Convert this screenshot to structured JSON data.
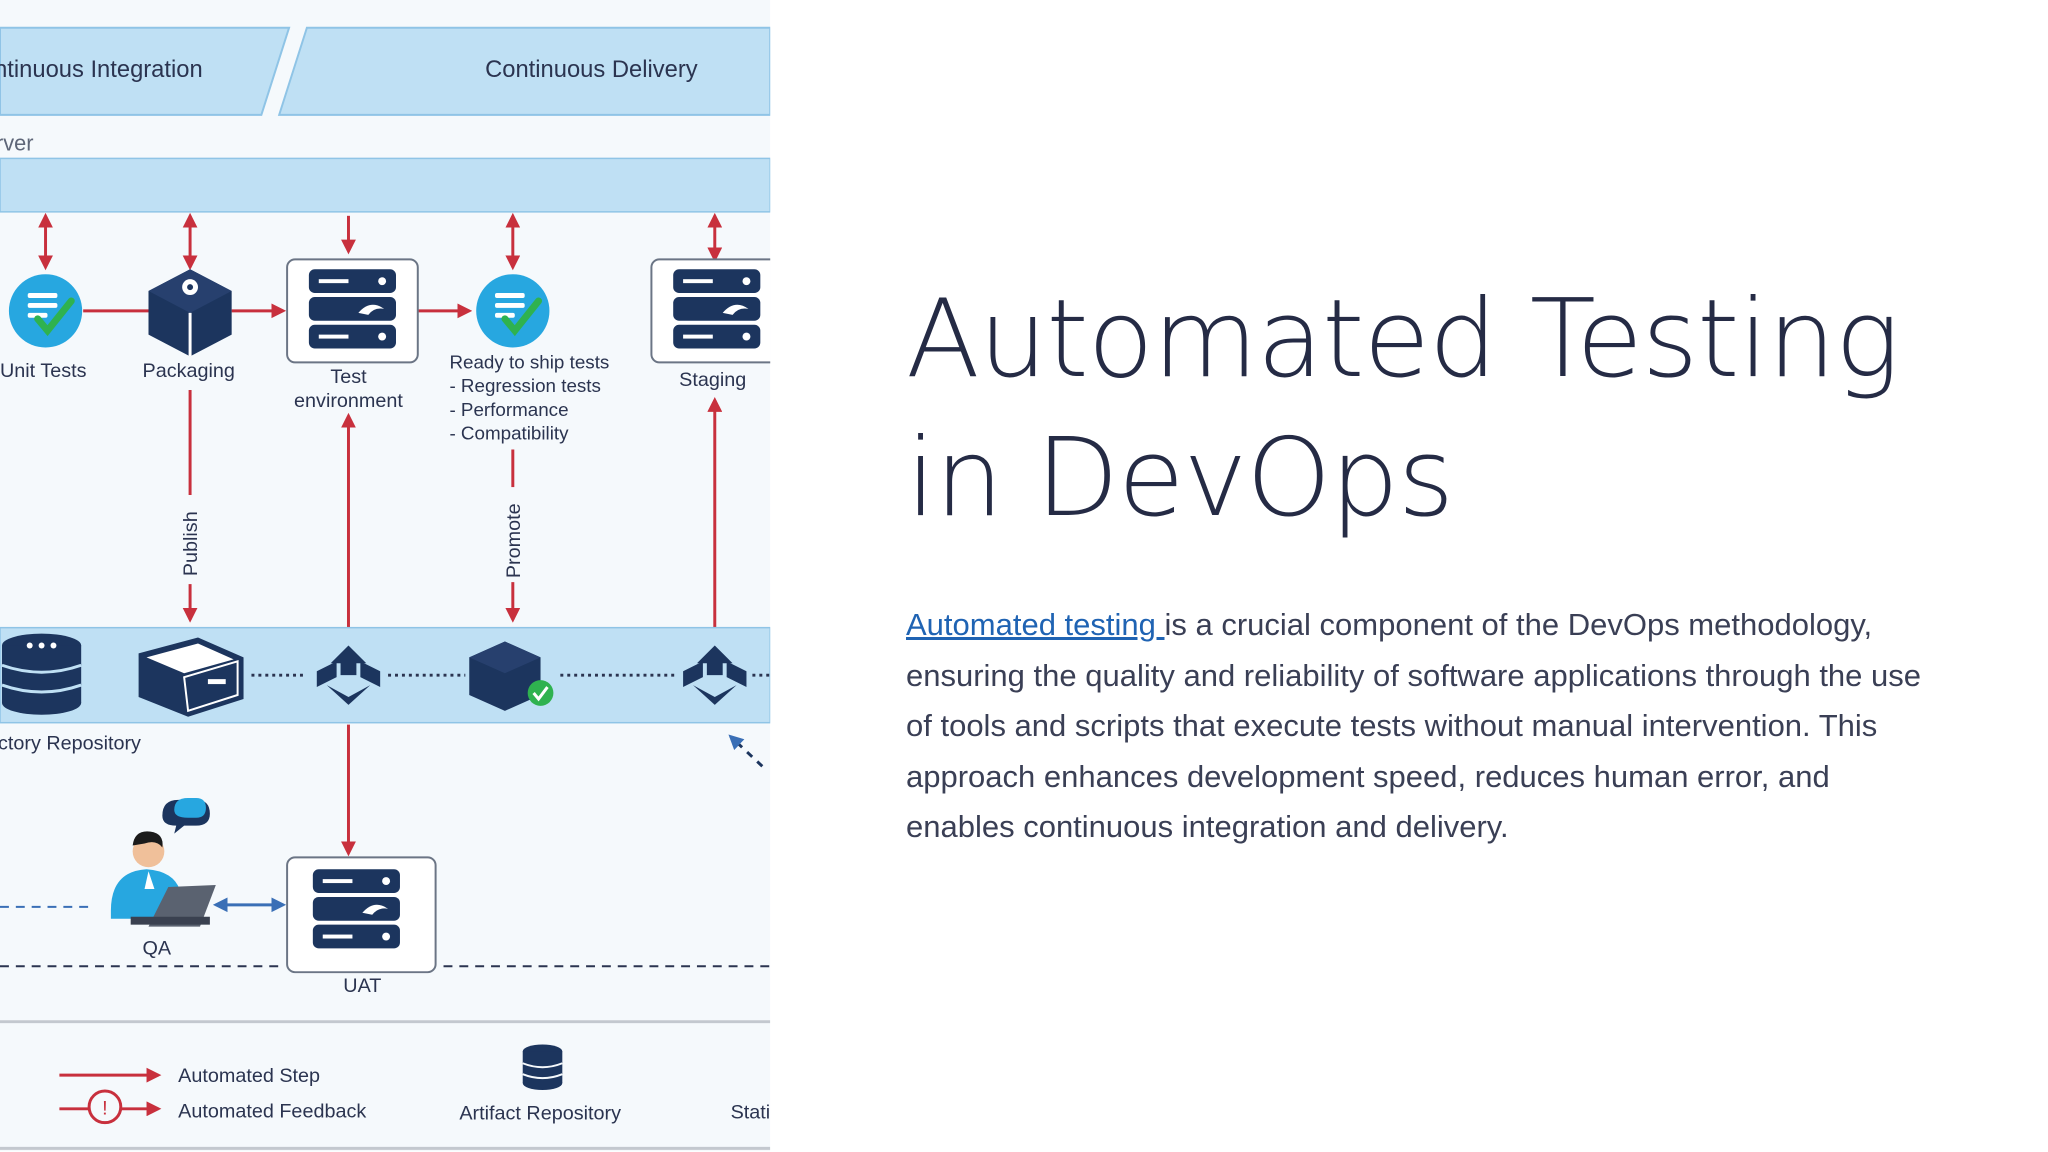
{
  "diagram": {
    "phases": [
      "ntinuous Integration",
      "Continuous Delivery"
    ],
    "server_label": "rver",
    "steps": {
      "unit_tests": "Unit Tests",
      "packaging": "Packaging",
      "test_env_line1": "Test",
      "test_env_line2": "environment",
      "ready_tests": [
        "Ready to ship tests",
        "- Regression tests",
        "- Performance",
        "- Compatibility"
      ],
      "staging": "Staging",
      "qa": "QA",
      "uat": "UAT"
    },
    "edge_labels": {
      "publish": "Publish",
      "promote": "Promote"
    },
    "repository_label": "ctory Repository",
    "legend": {
      "automated_step": "Automated Step",
      "automated_feedback": "Automated Feedback",
      "artifact_repository": "Artifact Repository",
      "partial": "Stati"
    },
    "colors": {
      "band": "#bfe0f4",
      "arrow": "#c8303d",
      "navy": "#1c355e",
      "accent": "#27a7e0",
      "check": "#2fb24f"
    }
  },
  "heading": "Automated Testing in DevOps",
  "paragraph": {
    "link_text": "Automated testing ",
    "text": "is a crucial component of the DevOps methodology, ensuring the quality and reliability of software applications through the use of tools and scripts that execute tests without manual intervention. This approach enhances development speed, reduces human error, and enables continuous integration and delivery."
  }
}
